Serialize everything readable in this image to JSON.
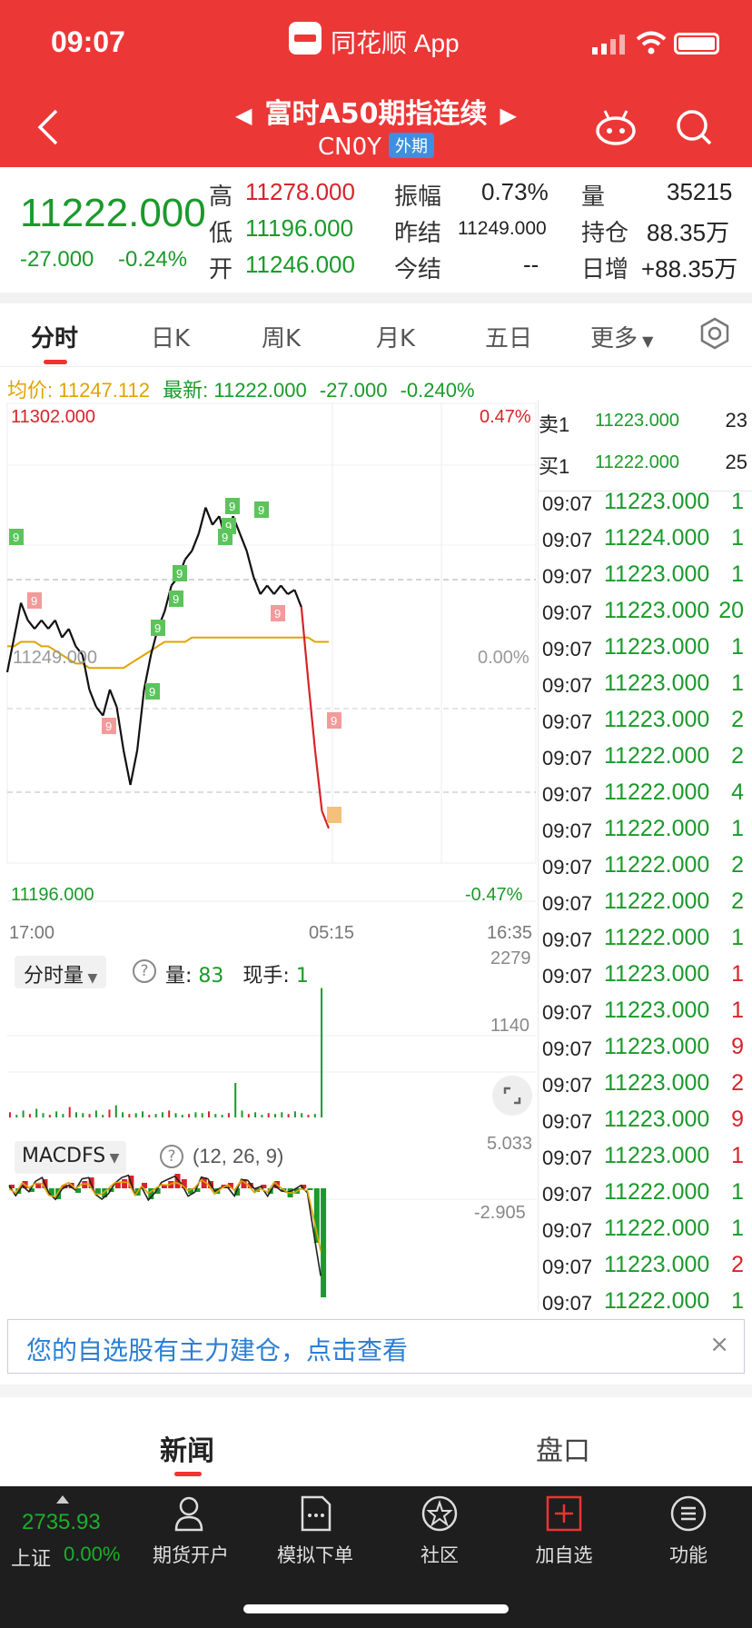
{
  "status_bar": {
    "time": "09:07",
    "app_name": "同花顺 App"
  },
  "header": {
    "title": "富时A50期指连续",
    "code": "CN0Y",
    "exchange_badge": "外期"
  },
  "quote": {
    "last_price": "11222.000",
    "change": "-27.000",
    "change_pct": "-0.24%",
    "high_label": "高",
    "high": "11278.000",
    "low_label": "低",
    "low": "11196.000",
    "open_label": "开",
    "open": "11246.000",
    "amplitude_label": "振幅",
    "amplitude": "0.73%",
    "prev_settle_label": "昨结",
    "prev_settle": "11249.000",
    "settle_label": "今结",
    "settle": "--",
    "volume_label": "量",
    "volume": "35215",
    "open_interest_label": "持仓",
    "open_interest": "88.35万",
    "daily_inc_label": "日增",
    "daily_inc": "+88.35万"
  },
  "tabs": [
    "分时",
    "日K",
    "周K",
    "月K",
    "五日",
    "更多"
  ],
  "info_line": {
    "avg_label": "均价:",
    "avg": "11247.112",
    "latest_label": "最新:",
    "latest": "11222.000",
    "chg": "-27.000",
    "pct": "-0.240%"
  },
  "chart_labels": {
    "high": "11302.000",
    "high_pct": "0.47%",
    "mid": "11249.000",
    "mid_pct": "0.00%",
    "low": "11196.000",
    "low_pct": "-0.47%",
    "t_start": "17:00",
    "t_mid": "05:15",
    "t_end": "16:35"
  },
  "chart_data": {
    "type": "line",
    "series": [],
    "x": [
      "17:00",
      "05:15",
      "16:35"
    ],
    "ylim": [
      11196,
      11302
    ],
    "price": [
      11240,
      11248,
      11256,
      11252,
      11250,
      11252,
      11250,
      11252,
      11248,
      11250,
      11246,
      11244,
      11236,
      11232,
      11230,
      11236,
      11232,
      11222,
      11214,
      11222,
      11236,
      11244,
      11250,
      11254,
      11260,
      11262,
      11266,
      11268,
      11272,
      11278,
      11274,
      11276,
      11270,
      11276,
      11272,
      11268,
      11262,
      11258,
      11260,
      11258,
      11260,
      11258,
      11259,
      11255,
      11238,
      11222,
      11208,
      11204
    ],
    "avg": [
      11246,
      11246,
      11247,
      11247,
      11247,
      11246,
      11246,
      11245,
      11244,
      11243,
      11242,
      11242,
      11241,
      11241,
      11241,
      11241,
      11241,
      11241,
      11242,
      11243,
      11244,
      11245,
      11246,
      11247,
      11247,
      11247,
      11247,
      11248,
      11248,
      11248,
      11248,
      11248,
      11248,
      11248,
      11248,
      11248,
      11248,
      11248,
      11248,
      11248,
      11248,
      11248,
      11248,
      11248,
      11248,
      11247,
      11247,
      11247
    ],
    "volume_ticks": {
      "max": "2279",
      "mid": "1140"
    },
    "macd_ticks": {
      "max": "5.033",
      "mid": "-2.905"
    },
    "macd_params": "(12, 26, 9)"
  },
  "volume_panel": {
    "selector": "分时量",
    "help": "?",
    "vol_label": "量:",
    "vol": "83",
    "hand_label": "现手:",
    "hand": "1"
  },
  "macd_panel": {
    "selector": "MACDFS",
    "help": "?"
  },
  "orderbook": {
    "sell": {
      "label": "卖1",
      "price": "11223.000",
      "qty": "23"
    },
    "buy": {
      "label": "买1",
      "price": "11222.000",
      "qty": "25"
    }
  },
  "ticks": [
    {
      "time": "09:07",
      "price": "11223.000",
      "qty": "1",
      "dir": "green"
    },
    {
      "time": "09:07",
      "price": "11224.000",
      "qty": "1",
      "dir": "green"
    },
    {
      "time": "09:07",
      "price": "11223.000",
      "qty": "1",
      "dir": "green"
    },
    {
      "time": "09:07",
      "price": "11223.000",
      "qty": "20",
      "dir": "green"
    },
    {
      "time": "09:07",
      "price": "11223.000",
      "qty": "1",
      "dir": "green"
    },
    {
      "time": "09:07",
      "price": "11223.000",
      "qty": "1",
      "dir": "green"
    },
    {
      "time": "09:07",
      "price": "11223.000",
      "qty": "2",
      "dir": "green"
    },
    {
      "time": "09:07",
      "price": "11222.000",
      "qty": "2",
      "dir": "green"
    },
    {
      "time": "09:07",
      "price": "11222.000",
      "qty": "4",
      "dir": "green"
    },
    {
      "time": "09:07",
      "price": "11222.000",
      "qty": "1",
      "dir": "green"
    },
    {
      "time": "09:07",
      "price": "11222.000",
      "qty": "2",
      "dir": "green"
    },
    {
      "time": "09:07",
      "price": "11222.000",
      "qty": "2",
      "dir": "green"
    },
    {
      "time": "09:07",
      "price": "11222.000",
      "qty": "1",
      "dir": "green"
    },
    {
      "time": "09:07",
      "price": "11223.000",
      "qty": "1",
      "dir": "red"
    },
    {
      "time": "09:07",
      "price": "11223.000",
      "qty": "1",
      "dir": "red"
    },
    {
      "time": "09:07",
      "price": "11223.000",
      "qty": "9",
      "dir": "red"
    },
    {
      "time": "09:07",
      "price": "11223.000",
      "qty": "2",
      "dir": "red"
    },
    {
      "time": "09:07",
      "price": "11223.000",
      "qty": "9",
      "dir": "red"
    },
    {
      "time": "09:07",
      "price": "11223.000",
      "qty": "1",
      "dir": "red"
    },
    {
      "time": "09:07",
      "price": "11222.000",
      "qty": "1",
      "dir": "green"
    },
    {
      "time": "09:07",
      "price": "11222.000",
      "qty": "1",
      "dir": "green"
    },
    {
      "time": "09:07",
      "price": "11223.000",
      "qty": "2",
      "dir": "red"
    },
    {
      "time": "09:07",
      "price": "11222.000",
      "qty": "1",
      "dir": "green"
    }
  ],
  "banner": {
    "text": "您的自选股有主力建仓，点击查看",
    "close": "×"
  },
  "bottom_tabs": {
    "news": "新闻",
    "pankou": "盘口"
  },
  "bottom_bar": {
    "index_value": "2735.93",
    "index_name": "上证",
    "index_pct": "0.00%",
    "items": [
      {
        "label": "期货开户",
        "icon": "person-icon"
      },
      {
        "label": "模拟下单",
        "icon": "document-icon"
      },
      {
        "label": "社区",
        "icon": "community-icon"
      },
      {
        "label": "加自选",
        "icon": "add-icon"
      },
      {
        "label": "功能",
        "icon": "menu-icon"
      }
    ]
  },
  "colors": {
    "header_bg": "#ec3737",
    "up": "#d8232a",
    "down": "#1a9a2a",
    "avg_line": "#e0a300",
    "banner_text": "#2b7fd4"
  }
}
